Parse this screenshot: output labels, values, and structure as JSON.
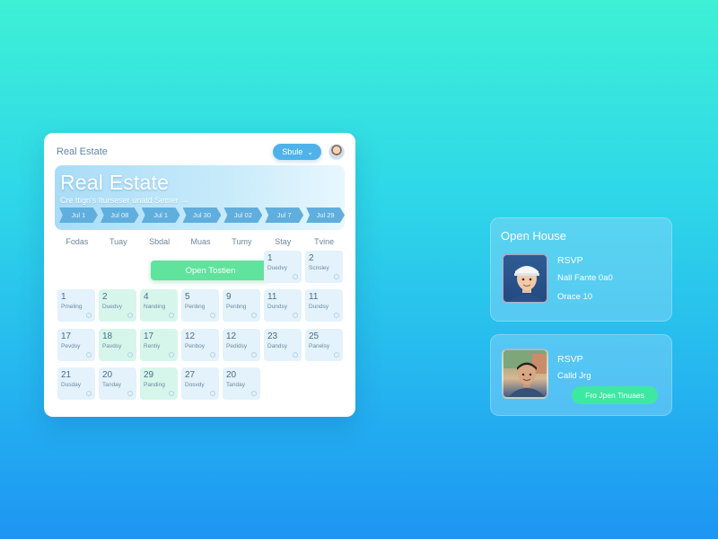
{
  "calendar": {
    "app_title": "Real Estate",
    "view_select": "Sbule",
    "hero_title": "Real Estate",
    "hero_subtitle": "Cre ttign's Iturseser unatd Semer →",
    "chips": [
      "Jul 1",
      "Jul 08",
      "Jul 1",
      "Jul 30",
      "Jul 02",
      "Jul 7",
      "Jul 29"
    ],
    "weekdays": [
      "Fodas",
      "Tuay",
      "Sbdal",
      "Muas",
      "Tumy",
      "Stay",
      "Tvine"
    ],
    "event_label": "Open Tostien",
    "days": [
      {
        "num": "1",
        "label": "Duedvy",
        "green": false
      },
      {
        "num": "2",
        "label": "Scnsley",
        "green": false
      },
      {
        "num": "1",
        "label": "Pmeling",
        "green": false
      },
      {
        "num": "2",
        "label": "Duedvy",
        "green": true
      },
      {
        "num": "4",
        "label": "Nanding",
        "green": true
      },
      {
        "num": "5",
        "label": "Penbng",
        "green": false
      },
      {
        "num": "9",
        "label": "Penbng",
        "green": false
      },
      {
        "num": "11",
        "label": "Dundsy",
        "green": false
      },
      {
        "num": "11",
        "label": "Dundsy",
        "green": false
      },
      {
        "num": "17",
        "label": "Pevdsy",
        "green": false
      },
      {
        "num": "18",
        "label": "Pavdsy",
        "green": true
      },
      {
        "num": "17",
        "label": "Rentiy",
        "green": true
      },
      {
        "num": "12",
        "label": "Penboy",
        "green": false
      },
      {
        "num": "12",
        "label": "Pedidsy",
        "green": false
      },
      {
        "num": "23",
        "label": "Dandsy",
        "green": false
      },
      {
        "num": "25",
        "label": "Panelsy",
        "green": false
      },
      {
        "num": "21",
        "label": "Dusday",
        "green": false
      },
      {
        "num": "20",
        "label": "Tanday",
        "green": false
      },
      {
        "num": "29",
        "label": "Panding",
        "green": true
      },
      {
        "num": "27",
        "label": "Dosvdy",
        "green": false
      },
      {
        "num": "20",
        "label": "Tanday",
        "green": false
      }
    ]
  },
  "open_house": {
    "title": "Open House",
    "rsvp": "RSVP",
    "line1": "Nall Fante 0a0",
    "line2": "Orace 10"
  },
  "rsvp_card": {
    "rsvp": "RSVP",
    "line1": "Calld Jrg",
    "button": "Fro Jpen Tinuaes"
  },
  "icons": {
    "view_chevron": "chevron-down-icon",
    "avatar": "user-avatar-icon",
    "day_dot": "circle-outline-icon"
  },
  "colors": {
    "accent_blue": "#4fb3ea",
    "accent_green": "#3fe8a1",
    "background_top": "#3ef0d6",
    "background_bottom": "#1e95f3"
  }
}
